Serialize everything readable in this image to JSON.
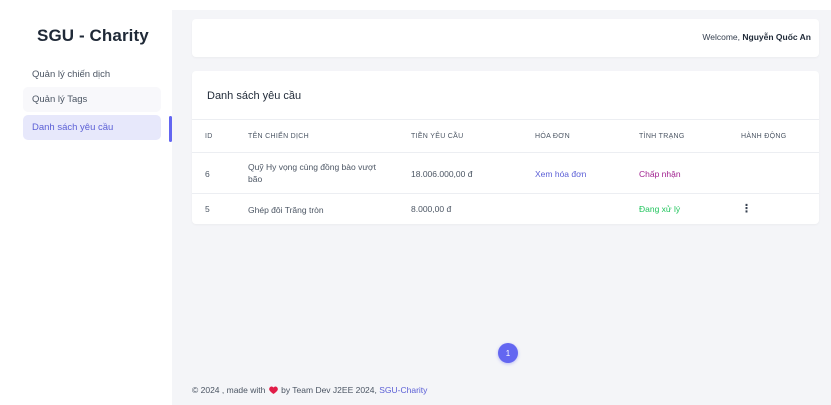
{
  "sidebar": {
    "brand": "SGU - Charity",
    "items": [
      {
        "label": "Quản lý chiến dịch"
      },
      {
        "label": "Quản lý Tags"
      },
      {
        "label": "Danh sách yêu cầu"
      }
    ]
  },
  "topbar": {
    "welcome_prefix": "Welcome, ",
    "user_name": "Nguyễn Quốc An"
  },
  "card": {
    "title": "Danh sách yêu cầu",
    "columns": [
      "ID",
      "TÊN CHIẾN DỊCH",
      "TIỀN YÊU CẦU",
      "HÓA ĐƠN",
      "TÌNH TRẠNG",
      "HÀNH ĐỘNG"
    ],
    "rows": [
      {
        "id": "6",
        "name": "Quỹ Hy vọng cùng đồng bào vượt bão",
        "amount": "18.006.000,00 đ",
        "bill": "Xem hóa đơn",
        "status": "Chấp nhận",
        "action": ""
      },
      {
        "id": "5",
        "name": "Ghép đôi Trăng tròn",
        "amount": "8.000,00 đ",
        "bill": "",
        "status": "Đang xử lý",
        "action": "⋮"
      }
    ]
  },
  "pagination": {
    "current": "1"
  },
  "footer": {
    "prefix": "© 2024 , made with",
    "suffix": "by Team Dev J2EE 2024,",
    "link": "SGU-Charity"
  },
  "colors": {
    "accent": "#6366f1",
    "status_accept": "#a1208f",
    "status_processing": "#22c55e",
    "heart": "#e11d48"
  },
  "icons": {
    "heart": "heart-icon",
    "more": "more-vertical-icon"
  }
}
